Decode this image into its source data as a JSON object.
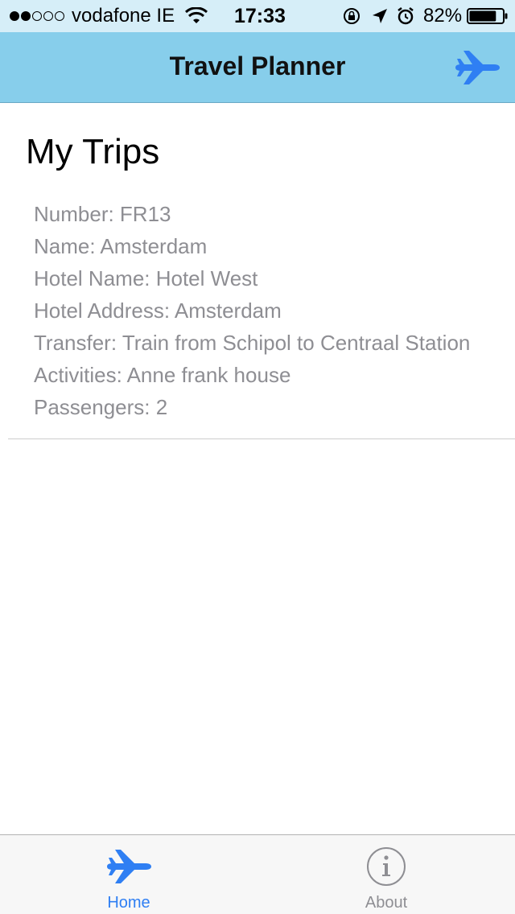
{
  "status_bar": {
    "signal_filled": 2,
    "signal_total": 5,
    "carrier": "vodafone IE",
    "time": "17:33",
    "battery_percent": "82%",
    "battery_level": 0.82,
    "icons": [
      "wifi-icon",
      "rotation-lock-icon",
      "location-icon",
      "alarm-icon",
      "battery-icon"
    ]
  },
  "nav": {
    "title": "Travel Planner",
    "action_icon": "plane-icon",
    "accent_color": "#2f7ff3",
    "bar_color": "#87ceeb"
  },
  "main": {
    "title": "My Trips",
    "trips": [
      {
        "lines": [
          "Number: FR13",
          "Name: Amsterdam",
          "Hotel Name: Hotel West",
          "Hotel Address: Amsterdam",
          "Transfer: Train from Schipol to Centraal Station",
          "Activities: Anne frank house",
          "Passengers: 2"
        ]
      }
    ]
  },
  "tabs": [
    {
      "label": "Home",
      "icon": "plane-icon",
      "selected": true
    },
    {
      "label": "About",
      "icon": "info-icon",
      "selected": false
    }
  ]
}
